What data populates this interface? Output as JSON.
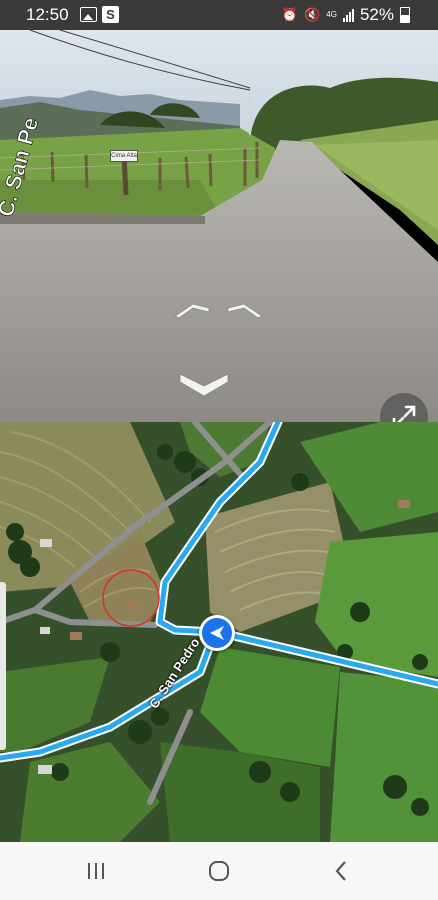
{
  "status_bar": {
    "time": "12:50",
    "notification_icons": [
      "gallery-icon",
      "s-app-icon"
    ],
    "signal_type": "4G",
    "battery_percent": "52%"
  },
  "street_view": {
    "road_sign_text": "Cima Alta",
    "corner_street_text": "C. San Pe",
    "controls": [
      "forward-left-arrow",
      "forward-right-arrow",
      "back-arrow",
      "expand-fullscreen"
    ]
  },
  "map": {
    "street_label": "C. San Pedro",
    "route_color": "#29a9f0",
    "marker_color": "#1a73e8",
    "highlight_color": "#d93025"
  },
  "nav_bar": {
    "buttons": [
      "recent-apps",
      "home",
      "back"
    ]
  }
}
